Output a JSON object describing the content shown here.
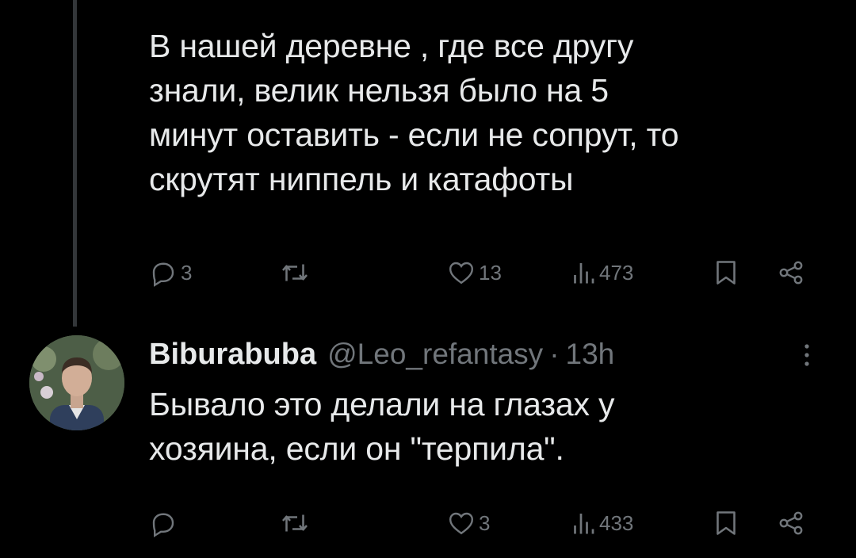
{
  "post1": {
    "lines": [
      "В нашей деревне , где все другу",
      "знали, велик нельзя было на 5",
      "минут оставить - если не сопрут, то",
      "скрутят ниппель и катафоты"
    ],
    "replies": "3",
    "reposts": "",
    "likes": "13",
    "views": "473"
  },
  "post2": {
    "author_name": "Biburabuba",
    "handle": "@Leo_refantasy",
    "separator": "·",
    "time": "13h",
    "lines": [
      "Бывало это делали на глазах у",
      "хозяина, если он \"терпила\"."
    ],
    "replies": "",
    "reposts": "",
    "likes": "3",
    "views": "433"
  },
  "icons": {
    "reply": "reply-icon",
    "repost": "repost-icon",
    "like": "heart-icon",
    "views": "views-icon",
    "bookmark": "bookmark-icon",
    "share": "share-icon",
    "more": "more-icon"
  },
  "colors": {
    "background": "#000000",
    "text": "#e7e9ea",
    "muted": "#71767b",
    "thread_line": "#333639"
  }
}
